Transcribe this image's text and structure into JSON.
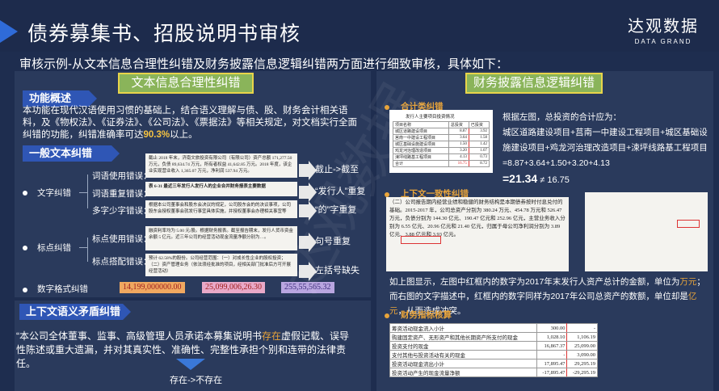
{
  "header": {
    "title": "债券募集书、招股说明书审核",
    "logo_cn": "达观数据",
    "logo_en": "DATA GRAND"
  },
  "subtitle": "审核示例-从文本信息合理性纠错及财务披露信息逻辑纠错两方面进行细致审核，具体如下：",
  "left": {
    "header": "文本信息合理性纠错",
    "overview_title": "功能概述",
    "overview_pre": "本功能在现代汉语使用习惯的基础上，结合语义理解与债、股、财务会计相关语料，及《物权法》、《证券法》、《公司法》、《票据法》等相关规定，对文档实行全面纠错的功能，纠错准确率可达",
    "overview_rate": "90.3%",
    "overview_post": "以上。",
    "general_title": "一般文本纠错",
    "word_error": "文字纠错",
    "word_usage": "词语使用错误：",
    "word_repeat": "词语重复错误：",
    "word_extra": "多字少字错误：",
    "punct_error": "标点纠错",
    "punct_usage": "标点使用错误：",
    "punct_match": "标点搭配错误：",
    "number_format": "数字格式纠错",
    "num1": "14,199,000000.00",
    "num2": "25,099,006,26.30",
    "num3": "255,55,565.32",
    "fix1": "截止->截至",
    "fix2": "“发行人”重复",
    "fix3": "“的”字重复",
    "fix4": "句号重复",
    "fix5": "左括号缺失",
    "doc1": "截止 2018 年末，济南文旅投资有限公司（有限公司）资产总额 171,277.50 万元，负债 89,634.74 万元，所有者权益 41,642.85 万元。2018 年度，该企业实现营业收入 1,365.07 万元，净利润 537.94 万元。",
    "doc2": "表 6-31 最近三年发行人发行人的企业合并财务报表主要数据",
    "doc3": "根据本公司董事会和股东会决议的规定，公司股东会的的决议事项，公司股东会授权董事会就发行事宜具体实施，并授权董事会办理相关事宜等",
    "doc4": "融资利率均为 5.00 元/股。根据财务报表。截至报告期末，发行人货币资金余额 5 亿元。近三年公司的经营活动现金流量净额分别为…。",
    "doc5": "预计 62.58%的股份。公司经营范围：（一）对成长性企业的股权投资；（二）资产管理业务（依法须经批准的项目，经相关部门批准后方可开展经营活动）"
  },
  "bottom_left": {
    "title": "上下文语义矛盾纠错",
    "quote_pre": "“本公司全体董事、监事、高级管理人员承诺本募集说明书",
    "quote_hl": "存在",
    "quote_post": "虚假记载、误导性陈述或重大遗漏，并对其真实性、准确性、完整性承担个别和连带的法律责任。",
    "fix": "存在->不存在"
  },
  "right": {
    "header": "财务披露信息逻辑纠错",
    "sec1": "合计类纠错",
    "sec2": "上下文一致性纠错",
    "sec3": "财务指标核算",
    "calc_intro": "根据左图，总投资的合计应为：",
    "calc_items": "城区道路建设项目+莒南一中建设工程项目+城区基础设施建设项目+鸡龙河治理改造项目+涑坪线路基工程项目",
    "calc_sum": "=8.87+3.64+1.50+3.20+4.13",
    "calc_result": "=21.34",
    "calc_neq": " ≠ 16.75",
    "table1_title": "发行人主要项目投资情况",
    "table1_head": [
      "项目名称",
      "总投资",
      "已投资"
    ],
    "table1_rows": [
      [
        "城区道路建设项目",
        "8.87",
        "3.92"
      ],
      [
        "莒南一中建设工程项目",
        "3.64",
        "1.58"
      ],
      [
        "城区基础设施建设项目",
        "1.50",
        "1.42"
      ],
      [
        "鸡龙河治理改造项目",
        "3.20",
        "1.07"
      ],
      [
        "涑坪线路基工程项目",
        "4.13",
        "0.73"
      ],
      [
        "合计",
        "16.75",
        "8.72"
      ]
    ],
    "ctx_doc1": "（二）公司报告期内经营业绩和稳健的财务结构是本期债券按时付息兑付的基础。2015-2017 年，公司总资产分别为 380.24 万元、454.78 万元和 526.47 万元，负债分别为 144.30 亿元、190.47 亿元和 252.96 亿元，主营业务收入分别为 6.55 亿元、20.96 亿元和 21.40 亿元，归属于母公司净利润分别为 3.89 亿元、3.88 亿元和 3.93 亿元。",
    "ctx_desc_pre": "如上图显示，左图中红框内的数字为2017年末发行人资产总计的金额，单位为",
    "ctx_unit1": "万元",
    "ctx_desc_mid": "；而右图的文字描述中，红框内的数字同样为2017年公司总资产的数额，单位却是",
    "ctx_unit2": "亿元",
    "ctx_desc_post": "，从而造成冲突。",
    "table2_rows": [
      [
        "筹资活动现金流入小计",
        "300.00",
        "-"
      ],
      [
        "购建固定资产、无形资产和其他长期资产所支付的现金",
        "1,028.10",
        "1,106.19"
      ],
      [
        "投资支付的现金",
        "16,867.37",
        "25,099.00"
      ],
      [
        "支付其他与投资活动有关的现金",
        "-",
        "3,090.00"
      ],
      [
        "投资活动现金流出小计",
        "17,895.47",
        "29,295.19"
      ],
      [
        "投资活动产生的现金流量净额",
        "-17,895.47",
        "-29,295.19"
      ]
    ]
  },
  "watermark": "达观数据"
}
